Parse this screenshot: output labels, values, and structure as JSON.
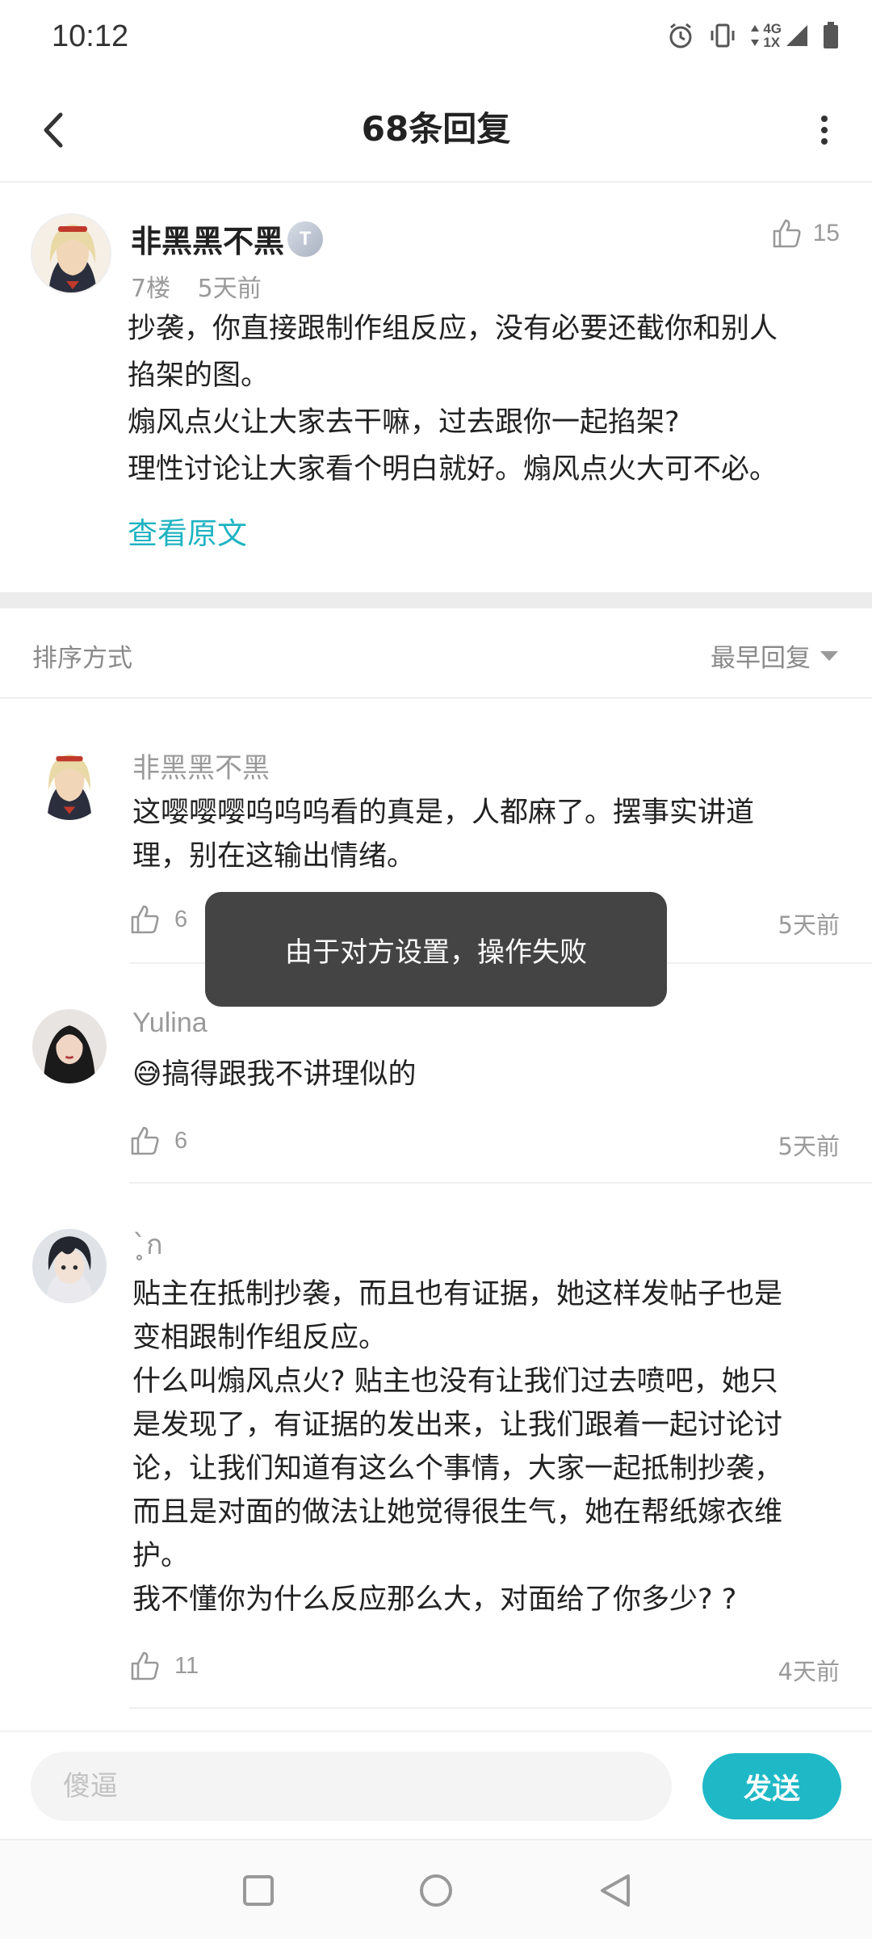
{
  "status_bar": {
    "time": "10:12",
    "network_label": "4G",
    "network_sub": "1X"
  },
  "header": {
    "title": "68条回复",
    "back_icon": "chevron-left-icon",
    "more_icon": "more-vertical-icon"
  },
  "post": {
    "author": "非黑黑不黑",
    "level": "T",
    "floor": "7楼",
    "time": "5天前",
    "likes": "15",
    "content": [
      "抄袭，你直接跟制作组反应，没有必要还截你和别人",
      "掐架的图。",
      "煽风点火让大家去干嘛，过去跟你一起掐架?",
      "理性讨论让大家看个明白就好。煽风点火大可不必。"
    ],
    "view_original": "查看原文"
  },
  "sort": {
    "label": "排序方式",
    "value": "最早回复"
  },
  "replies": [
    {
      "author": "非黑黑不黑",
      "text": [
        "这嘤嘤嘤呜呜呜看的真是，人都麻了。摆事实讲道",
        "理，别在这输出情绪。"
      ],
      "likes": "6",
      "time": "5天前"
    },
    {
      "author": "Yulina",
      "text": [
        "😅搞得跟我不讲理似的"
      ],
      "likes": "6",
      "time": "5天前"
    },
    {
      "author": "ˋ̥ก",
      "text": [
        "贴主在抵制抄袭，而且也有证据，她这样发帖子也是",
        "变相跟制作组反应。",
        "什么叫煽风点火? 贴主也没有让我们过去喷吧，她只",
        "是发现了，有证据的发出来，让我们跟着一起讨论讨",
        "论，让我们知道有这么个事情，大家一起抵制抄袭，",
        "而且是对面的做法让她觉得很生气，她在帮纸嫁衣维",
        "护。",
        "我不懂你为什么反应那么大，对面给了你多少? ?"
      ],
      "likes": "11",
      "time": "4天前"
    }
  ],
  "toast": {
    "message": "由于对方设置，操作失败"
  },
  "input_bar": {
    "placeholder": "傻逼",
    "send_label": "发送"
  },
  "nav_bar": {
    "icons": [
      "square-icon",
      "circle-icon",
      "triangle-back-icon"
    ]
  },
  "colors": {
    "accent": "#1fb8c6",
    "link": "#1fb3c2",
    "toast_bg": "#3c3c3c"
  }
}
